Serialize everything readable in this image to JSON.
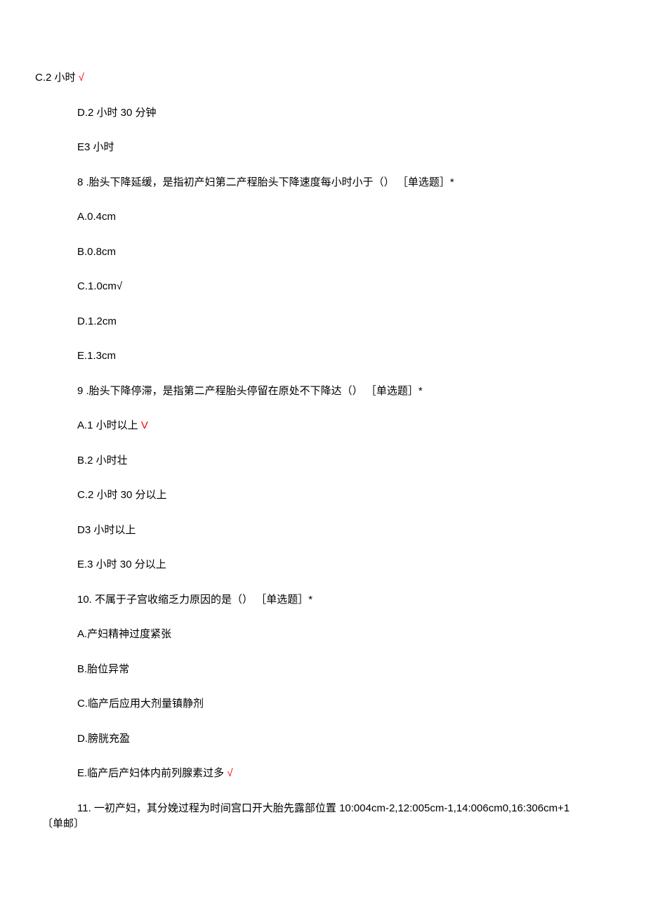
{
  "q7": {
    "optC": "C.2 小时",
    "optC_mark": " √",
    "optD": "D.2 小时 30 分钟",
    "optE": "E3 小时"
  },
  "q8": {
    "stem": "8   .胎头下降延缓，是指初产妇第二产程胎头下降速度每小时小于（） ［单选题］*",
    "optA": "A.0.4cm",
    "optB": "B.0.8cm",
    "optC": "C.1.0cm√",
    "optD": "D.1.2cm",
    "optE": "E.1.3cm"
  },
  "q9": {
    "stem": "9   .胎头下降停滞，是指第二产程胎头停留在原处不下降达（） ［单选题］*",
    "optA": "A.1 小时以上",
    "optA_mark": " V",
    "optB": "B.2 小时壮",
    "optC": "C.2 小时 30 分以上",
    "optD": "D3 小时以上",
    "optE": "E.3 小时 30 分以上"
  },
  "q10": {
    "stem": "10. 不属于子宫收缩乏力原因的是（） ［单选题］*",
    "optA": "A.产妇精神过度紧张",
    "optB": "B.胎位异常",
    "optC": "C.临产后应用大剂量镇静剂",
    "optD": "D.膀胱充盈",
    "optE": "E.临产后产妇体内前列腺素过多",
    "optE_mark": " √"
  },
  "q11": {
    "stem": "11. 一初产妇，其分娩过程为时间宫口开大胎先露部位置 10:004cm-2,12:005cm-1,14:006cm0,16:306cm+1",
    "tail": "〔单邮〕"
  }
}
